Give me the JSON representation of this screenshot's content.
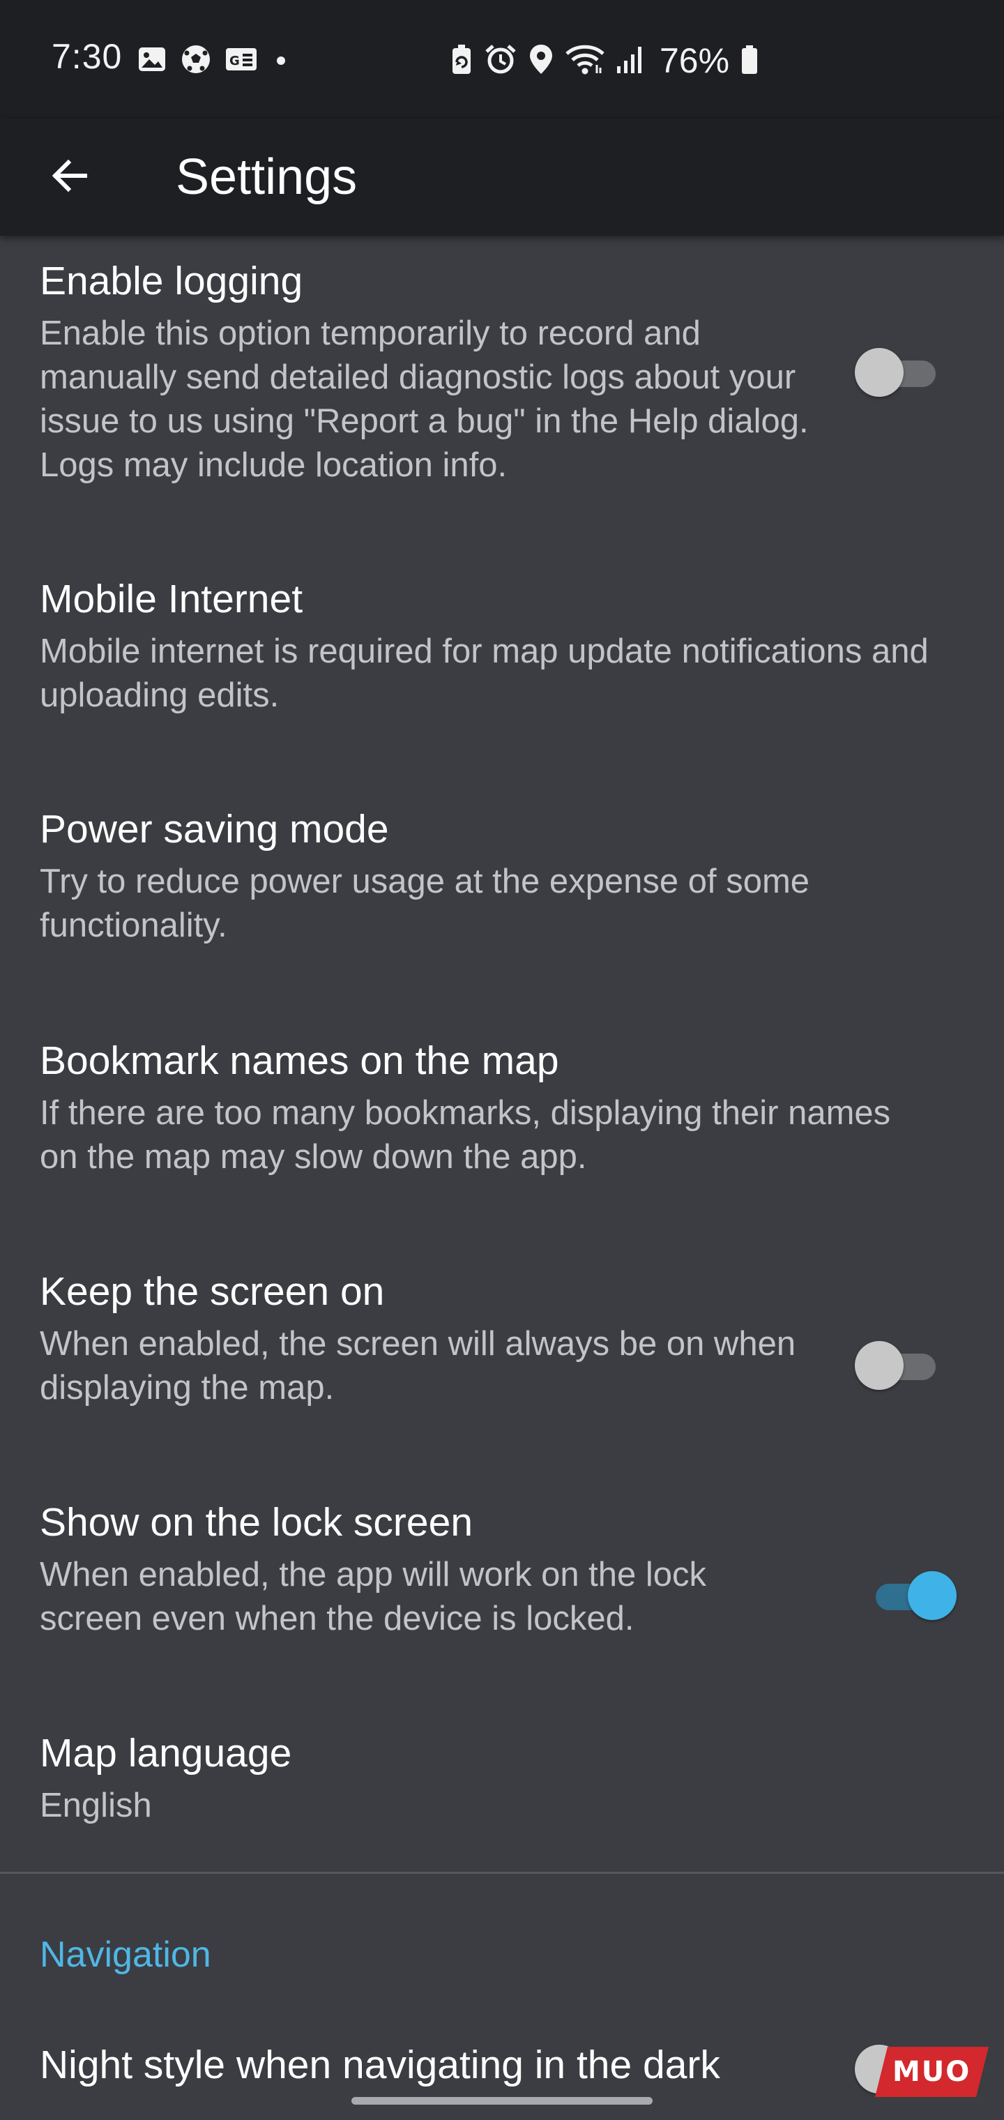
{
  "status_bar": {
    "time": "7:30",
    "battery_percent": "76%",
    "left_icons": [
      "gallery-icon",
      "soccer-ball-icon",
      "news-icon",
      "dot-icon"
    ],
    "right_icons": [
      "battery-saver-icon",
      "alarm-icon",
      "location-icon",
      "wifi-icon",
      "signal-icon",
      "battery-icon"
    ]
  },
  "app_bar": {
    "title": "Settings",
    "back_icon": "arrow-left-icon"
  },
  "settings": [
    {
      "title": "Enable logging",
      "description": "Enable this option temporarily to record and manually send detailed diagnostic logs about your issue to us using \"Report a bug\" in the Help dialog. Logs may include location info.",
      "toggle": "off"
    },
    {
      "title": "Mobile Internet",
      "description": "Mobile internet is required for map update notifications and uploading edits."
    },
    {
      "title": "Power saving mode",
      "description": "Try to reduce power usage at the expense of some functionality."
    },
    {
      "title": "Bookmark names on the map",
      "description": "If there are too many bookmarks, displaying their names on the map may slow down the app."
    },
    {
      "title": "Keep the screen on",
      "description": "When enabled, the screen will always be on when displaying the map.",
      "toggle": "off"
    },
    {
      "title": "Show on the lock screen",
      "description": "When enabled, the app will work on the lock screen even when the device is locked.",
      "toggle": "on"
    },
    {
      "title": "Map language",
      "description": "English"
    }
  ],
  "navigation_section": {
    "header": "Navigation",
    "items": [
      {
        "title": "Night style when navigating in the dark",
        "toggle": "off"
      }
    ]
  },
  "watermark": "MUO",
  "colors": {
    "background": "#3b3d42",
    "bar_background": "#1d1f23",
    "accent": "#4fb7e6",
    "toggle_on": "#3fb3e7",
    "watermark": "#d3282d"
  }
}
